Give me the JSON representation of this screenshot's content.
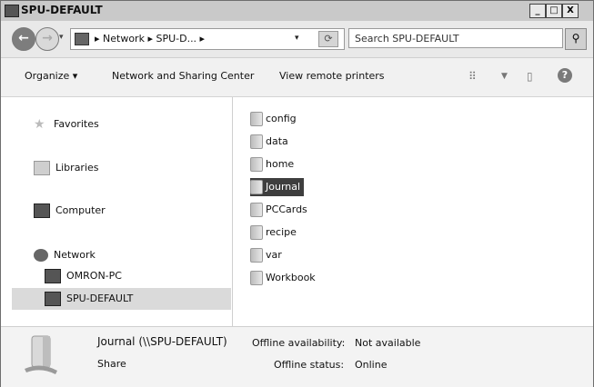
{
  "window": {
    "title": "SPU-DEFAULT",
    "minimize": "_",
    "maximize": "□",
    "close": "X"
  },
  "address": {
    "breadcrumb": "▸ Network ▸ SPU-D... ▸",
    "search_placeholder": "Search SPU-DEFAULT"
  },
  "toolbar": {
    "organize": "Organize ▾",
    "network_sharing": "Network and Sharing Center",
    "view_printers": "View remote printers"
  },
  "nav": {
    "favorites": "Favorites",
    "libraries": "Libraries",
    "computer": "Computer",
    "network": "Network",
    "omron": "OMRON-PC",
    "spu": "SPU-DEFAULT"
  },
  "files": [
    "config",
    "data",
    "home",
    "Journal",
    "PCCards",
    "recipe",
    "var",
    "Workbook"
  ],
  "selected_file": "Journal",
  "details": {
    "name": "Journal (\\\\SPU-DEFAULT)",
    "type": "Share",
    "offline_availability_label": "Offline availability:",
    "offline_availability_value": "Not available",
    "offline_status_label": "Offline status:",
    "offline_status_value": "Online"
  },
  "colors": {
    "selected_bg": "#3e3e3e",
    "nav_selected_bg": "#dadada"
  }
}
